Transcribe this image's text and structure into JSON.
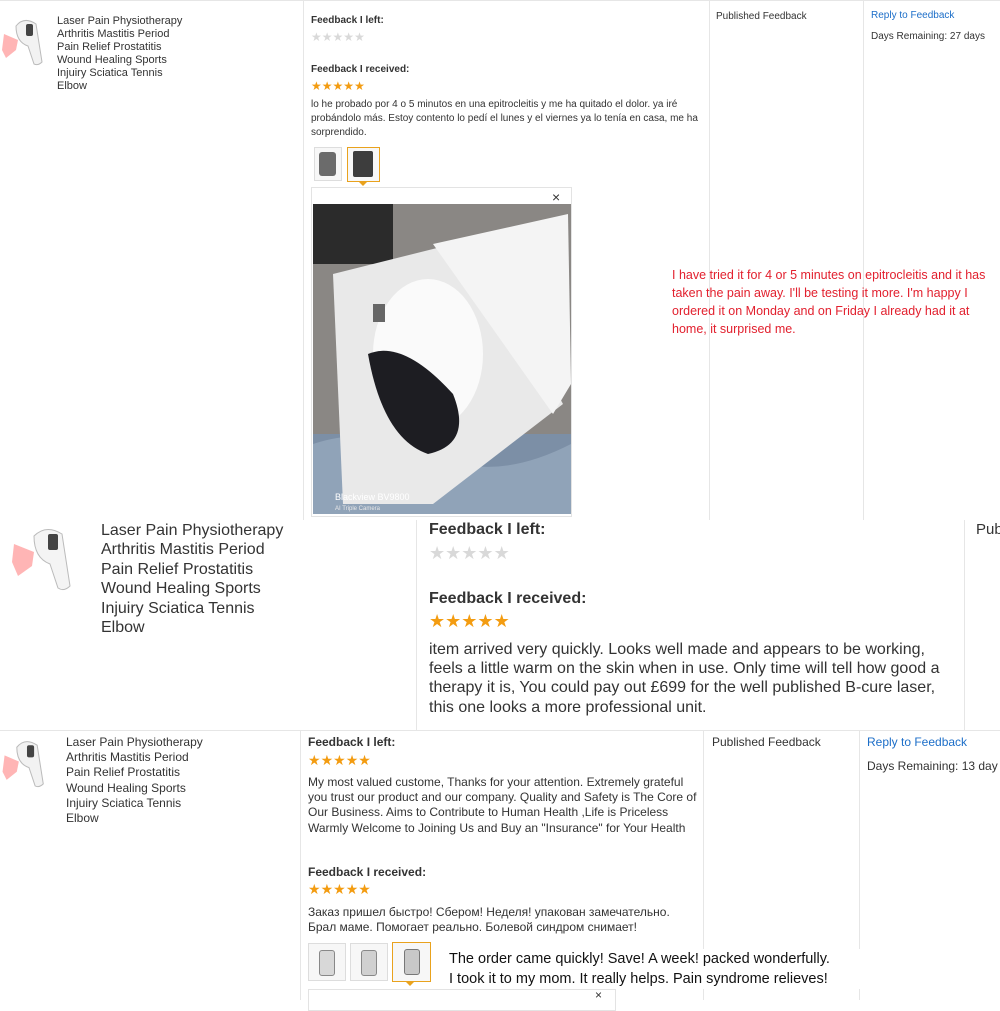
{
  "product_title": "Laser Pain Physiotherapy\nArthritis Mastitis Period\nPain Relief Prostatitis\nWound Healing Sports\nInjuiry Sciatica Tennis\nElbow",
  "block1": {
    "feedback_left_label": "Feedback I left:",
    "left_stars": 0,
    "feedback_received_label": "Feedback I received:",
    "received_stars": 5,
    "review_text": "lo he probado por 4 o 5 minutos en una epitrocleitis y me ha quitado el dolor. ya iré probándolo más. Estoy contento lo pedí el lunes y el viernes ya lo tenía en casa, me ha sorprendido.",
    "status": "Published Feedback",
    "reply_link": "Reply to Feedback",
    "days_remaining": "Days Remaining: 27 days",
    "close_symbol": "×",
    "photo_watermark_1": "Blackview BV9800",
    "photo_watermark_2": "AI Triple Camera",
    "translation": "I have tried it for 4 or 5 minutes on epitrocleitis and it has taken the pain away. I'll be testing it more. I'm happy I ordered it on Monday and on Friday I already had it at home, it surprised me."
  },
  "block2": {
    "feedback_left_label": "Feedback I left:",
    "left_stars": 0,
    "feedback_received_label": "Feedback I received:",
    "received_stars": 5,
    "review_text": "item arrived very quickly. Looks well made and appears to be working, feels a little warm on the skin when in use. Only time will tell how good a therapy it is, You could pay out £699 for the well published B-cure laser, this one looks a more professional unit.",
    "status_clipped": "Pub"
  },
  "block3": {
    "feedback_left_label": "Feedback I left:",
    "left_stars": 5,
    "seller_reply": "My most valued custome, Thanks for your attention. Extremely grateful you trust our product and our company. Quality and Safety is The Core of Our Business. Aims to Contribute to Human Health ,Life is Priceless Warmly Welcome to Joining Us and Buy an \"Insurance\" for Your Health",
    "feedback_received_label": "Feedback I received:",
    "received_stars": 5,
    "review_text": "Заказ пришел быстро! Сбером! Неделя! упакован замечательно. Брал маме. Помогает реально. Болевой синдром снимает!",
    "status": "Published Feedback",
    "reply_link": "Reply to Feedback",
    "days_remaining": "Days Remaining: 13 day",
    "close_symbol": "×",
    "translation": "The order came quickly! Save! A week! packed wonderfully.\n I took it to my mom. It really helps. Pain syndrome relieves!"
  },
  "colors": {
    "star_on": "#f39c11",
    "star_off": "#d9d9d9",
    "link": "#1c6ec8",
    "translation": "#e2202e",
    "selected_thumb": "#e9a21d"
  },
  "icons": [
    "laser-device-icon",
    "star-icon",
    "close-icon"
  ]
}
